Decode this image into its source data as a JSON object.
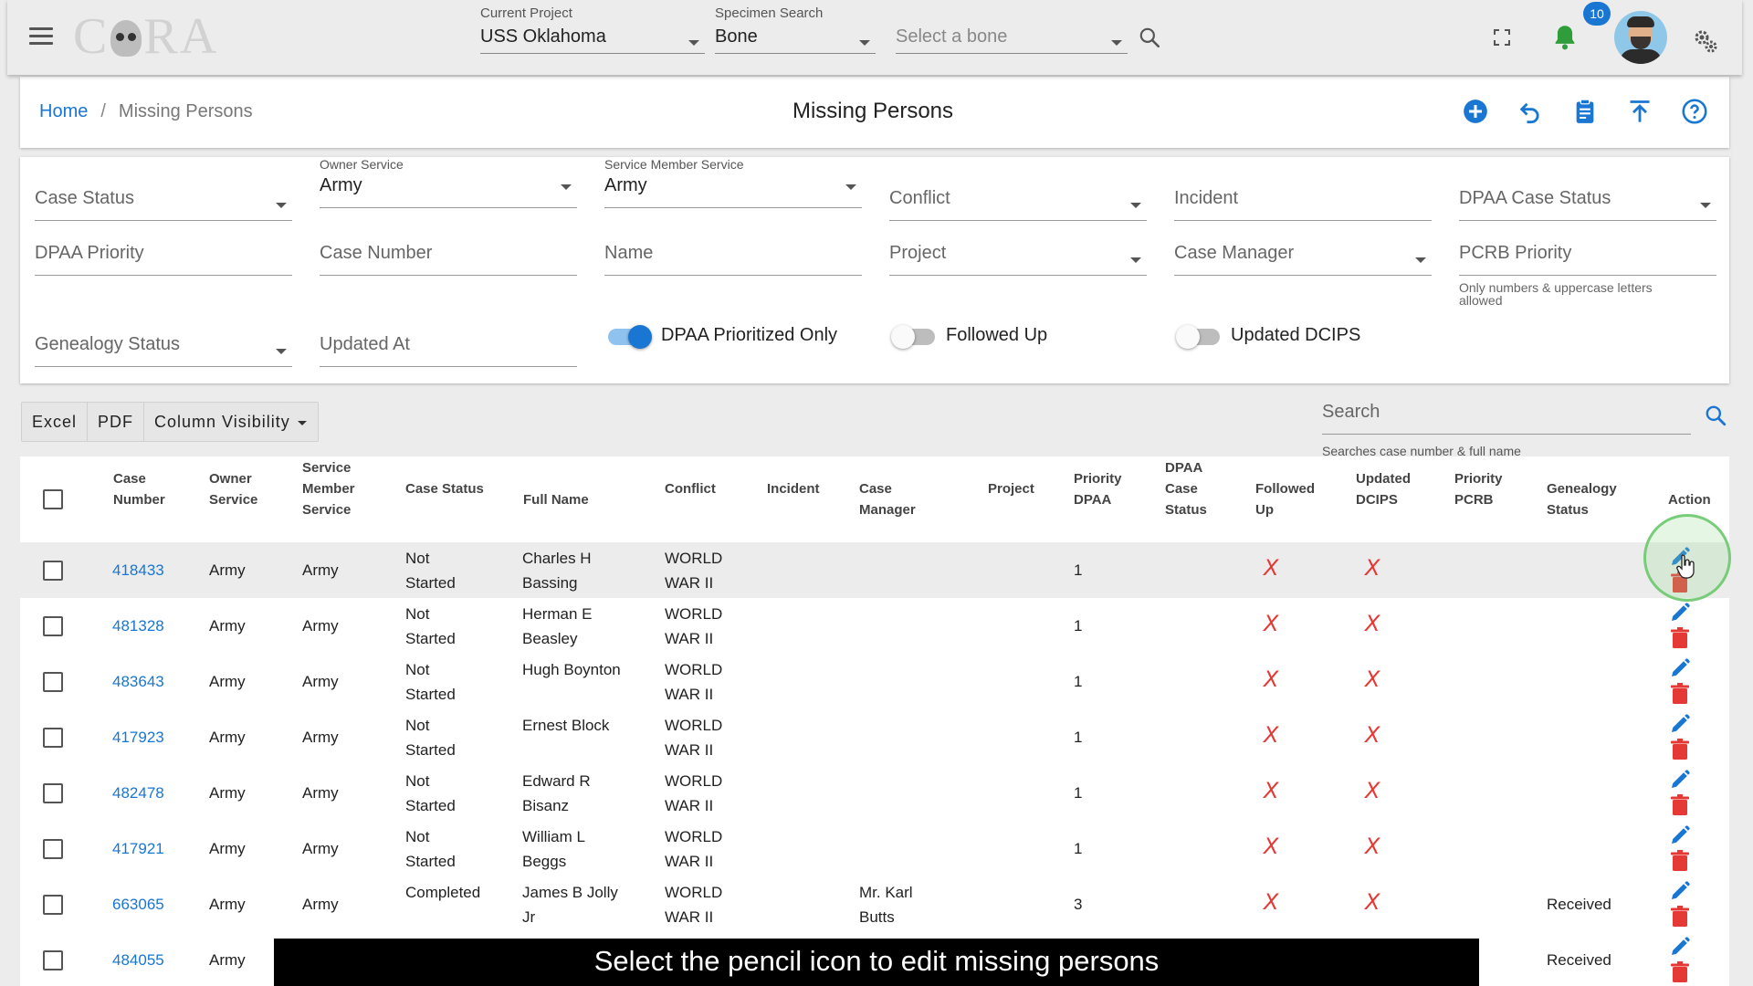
{
  "app": {
    "logo_text": "CORA",
    "current_project": {
      "label": "Current Project",
      "value": "USS Oklahoma"
    },
    "specimen_search": {
      "label": "Specimen Search",
      "value": "Bone"
    },
    "bone_select": {
      "placeholder": "Select a bone"
    },
    "notification_count": "10"
  },
  "breadcrumb": {
    "home": "Home",
    "separator": "/",
    "current": "Missing Persons"
  },
  "page_title": "Missing Persons",
  "filters": {
    "case_status": {
      "label": "",
      "value": "Case Status"
    },
    "owner_service": {
      "label": "Owner Service",
      "value": "Army"
    },
    "service_member_service": {
      "label": "Service Member Service",
      "value": "Army"
    },
    "conflict": {
      "label": "",
      "value": "Conflict"
    },
    "incident": {
      "label": "",
      "value": "Incident"
    },
    "dpaa_case_status": {
      "label": "",
      "value": "DPAA Case Status"
    },
    "dpaa_priority": {
      "value": "DPAA Priority"
    },
    "case_number": {
      "value": "Case Number"
    },
    "name": {
      "value": "Name"
    },
    "project": {
      "value": "Project"
    },
    "case_manager": {
      "value": "Case Manager"
    },
    "pcrb_priority": {
      "value": "PCRB Priority",
      "hint": "Only numbers & uppercase letters allowed"
    },
    "genealogy_status": {
      "value": "Genealogy Status"
    },
    "updated_at": {
      "value": "Updated At"
    },
    "toggles": [
      {
        "label": "DPAA Prioritized Only",
        "on": true
      },
      {
        "label": "Followed Up",
        "on": false
      },
      {
        "label": "Updated DCIPS",
        "on": false
      }
    ]
  },
  "toolbar": {
    "excel": "Excel",
    "pdf": "PDF",
    "column_visibility": "Column Visibility",
    "search_placeholder": "Search",
    "search_hint": "Searches case number & full name"
  },
  "table": {
    "headers": {
      "case_number": [
        "Case",
        "Number"
      ],
      "owner_service": [
        "Owner",
        "Service"
      ],
      "service_member_service": [
        "Service",
        "Member",
        "Service"
      ],
      "case_status": [
        "Case Status"
      ],
      "full_name": [
        "Full Name"
      ],
      "conflict": [
        "Conflict"
      ],
      "incident": [
        "Incident"
      ],
      "case_manager": [
        "Case",
        "Manager"
      ],
      "project": [
        "Project"
      ],
      "priority_dpaa": [
        "Priority",
        "DPAA"
      ],
      "dpaa_case_status": [
        "DPAA",
        "Case",
        "Status"
      ],
      "followed_up": [
        "Followed",
        "Up"
      ],
      "updated_dcips": [
        "Updated",
        "DCIPS"
      ],
      "priority_pcrb": [
        "Priority",
        "PCRB"
      ],
      "genealogy_status": [
        "Genealogy",
        "Status"
      ],
      "action": [
        "Action"
      ]
    },
    "rows": [
      {
        "case_number": "418433",
        "owner": "Army",
        "member": "Army",
        "status": [
          "Not",
          "Started"
        ],
        "name": [
          "Charles H",
          "Bassing"
        ],
        "conflict": [
          "WORLD",
          "WAR II"
        ],
        "manager": [
          "",
          ""
        ],
        "priority": "1",
        "followed_up": "X",
        "updated_dcips": "X",
        "genealogy": ""
      },
      {
        "case_number": "481328",
        "owner": "Army",
        "member": "Army",
        "status": [
          "Not",
          "Started"
        ],
        "name": [
          "Herman E",
          "Beasley"
        ],
        "conflict": [
          "WORLD",
          "WAR II"
        ],
        "manager": [
          "",
          ""
        ],
        "priority": "1",
        "followed_up": "X",
        "updated_dcips": "X",
        "genealogy": ""
      },
      {
        "case_number": "483643",
        "owner": "Army",
        "member": "Army",
        "status": [
          "Not",
          "Started"
        ],
        "name": [
          "Hugh Boynton",
          ""
        ],
        "conflict": [
          "WORLD",
          "WAR II"
        ],
        "manager": [
          "",
          ""
        ],
        "priority": "1",
        "followed_up": "X",
        "updated_dcips": "X",
        "genealogy": ""
      },
      {
        "case_number": "417923",
        "owner": "Army",
        "member": "Army",
        "status": [
          "Not",
          "Started"
        ],
        "name": [
          "Ernest Block",
          ""
        ],
        "conflict": [
          "WORLD",
          "WAR II"
        ],
        "manager": [
          "",
          ""
        ],
        "priority": "1",
        "followed_up": "X",
        "updated_dcips": "X",
        "genealogy": ""
      },
      {
        "case_number": "482478",
        "owner": "Army",
        "member": "Army",
        "status": [
          "Not",
          "Started"
        ],
        "name": [
          "Edward R",
          "Bisanz"
        ],
        "conflict": [
          "WORLD",
          "WAR II"
        ],
        "manager": [
          "",
          ""
        ],
        "priority": "1",
        "followed_up": "X",
        "updated_dcips": "X",
        "genealogy": ""
      },
      {
        "case_number": "417921",
        "owner": "Army",
        "member": "Army",
        "status": [
          "Not",
          "Started"
        ],
        "name": [
          "William L",
          "Beggs"
        ],
        "conflict": [
          "WORLD",
          "WAR II"
        ],
        "manager": [
          "",
          ""
        ],
        "priority": "1",
        "followed_up": "X",
        "updated_dcips": "X",
        "genealogy": ""
      },
      {
        "case_number": "663065",
        "owner": "Army",
        "member": "Army",
        "status": [
          "Completed",
          ""
        ],
        "name": [
          "James B Jolly",
          "Jr"
        ],
        "conflict": [
          "WORLD",
          "WAR II"
        ],
        "manager": [
          "Mr. Karl",
          "Butts"
        ],
        "priority": "3",
        "followed_up": "X",
        "updated_dcips": "X",
        "genealogy": "Received"
      },
      {
        "case_number": "484055",
        "owner": "Army",
        "member": "",
        "status": [
          "",
          ""
        ],
        "name": [
          "",
          ""
        ],
        "conflict": [
          "",
          ""
        ],
        "manager": [
          "",
          ""
        ],
        "priority": "",
        "followed_up": "",
        "updated_dcips": "",
        "genealogy": "Received"
      }
    ]
  },
  "caption": "Select the pencil icon to edit missing persons",
  "colors": {
    "primary": "#1976d2",
    "danger": "#e53935",
    "bell": "#2e9d3a"
  }
}
